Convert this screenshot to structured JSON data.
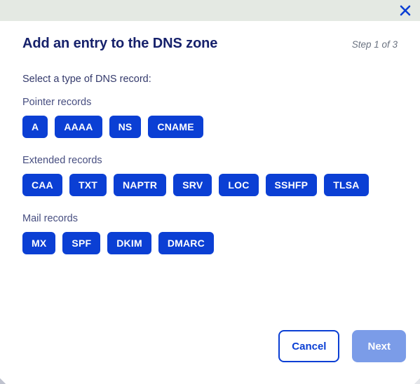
{
  "window": {
    "close_icon": "close-icon",
    "bar_color": "#e4e9e3",
    "close_color": "#0b3fd4"
  },
  "modal": {
    "title": "Add an entry to the DNS zone",
    "step": "Step 1 of 3",
    "intro": "Select a type of DNS record:",
    "accent_color": "#0b3fd4",
    "title_color": "#16216b",
    "disabled_color": "#7b9ce8",
    "groups": [
      {
        "label": "Pointer records",
        "records": [
          "A",
          "AAAA",
          "NS",
          "CNAME"
        ]
      },
      {
        "label": "Extended records",
        "records": [
          "CAA",
          "TXT",
          "NAPTR",
          "SRV",
          "LOC",
          "SSHFP",
          "TLSA"
        ]
      },
      {
        "label": "Mail records",
        "records": [
          "MX",
          "SPF",
          "DKIM",
          "DMARC"
        ]
      }
    ]
  },
  "footer": {
    "cancel_label": "Cancel",
    "next_label": "Next"
  }
}
